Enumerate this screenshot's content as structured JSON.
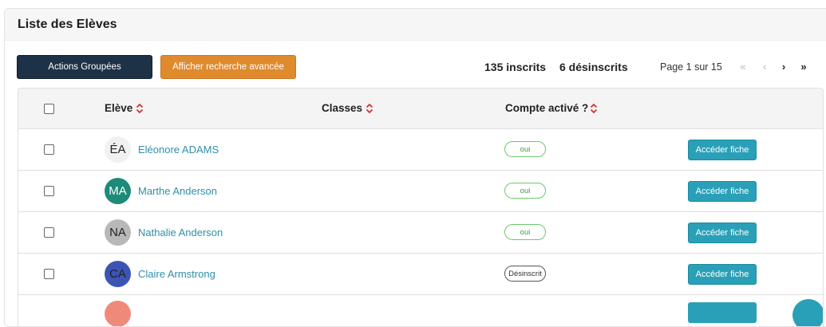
{
  "header": {
    "title": "Liste des Elèves"
  },
  "toolbar": {
    "group_actions_label": "Actions Groupées",
    "advanced_search_label": "Afficher recherche avancée",
    "enrolled": "135 inscrits",
    "unenrolled": "6 désinscrits",
    "page_info": "Page 1 sur 15",
    "pager": {
      "first": "«",
      "prev": "‹",
      "next": "›",
      "last": "»"
    }
  },
  "table": {
    "columns": {
      "student": "Elève",
      "classes": "Classes",
      "account_active": "Compte activé ?"
    },
    "open_button_label": "Accéder fiche",
    "rows": [
      {
        "initials": "ÉA",
        "name": "Eléonore ADAMS",
        "status": "oui",
        "avatar_color": "#f1f1f1",
        "avatar_text_color": "#222222"
      },
      {
        "initials": "MA",
        "name": "Marthe Anderson",
        "status": "oui",
        "avatar_color": "#1e8a78",
        "avatar_text_color": "#ffffff"
      },
      {
        "initials": "NA",
        "name": "Nathalie Anderson",
        "status": "oui",
        "avatar_color": "#b8b8b8",
        "avatar_text_color": "#222222"
      },
      {
        "initials": "CA",
        "name": "Claire Armstrong",
        "status": "Désinscrit",
        "avatar_color": "#3c55b5",
        "avatar_text_color": "#222222"
      }
    ]
  },
  "colors": {
    "primary_dark": "#1e3247",
    "accent_orange": "#e08a2e",
    "link_teal": "#2f8fa8",
    "button_teal": "#2aa0b8",
    "sort_red": "#d33333",
    "status_green": "#6cc86c"
  }
}
